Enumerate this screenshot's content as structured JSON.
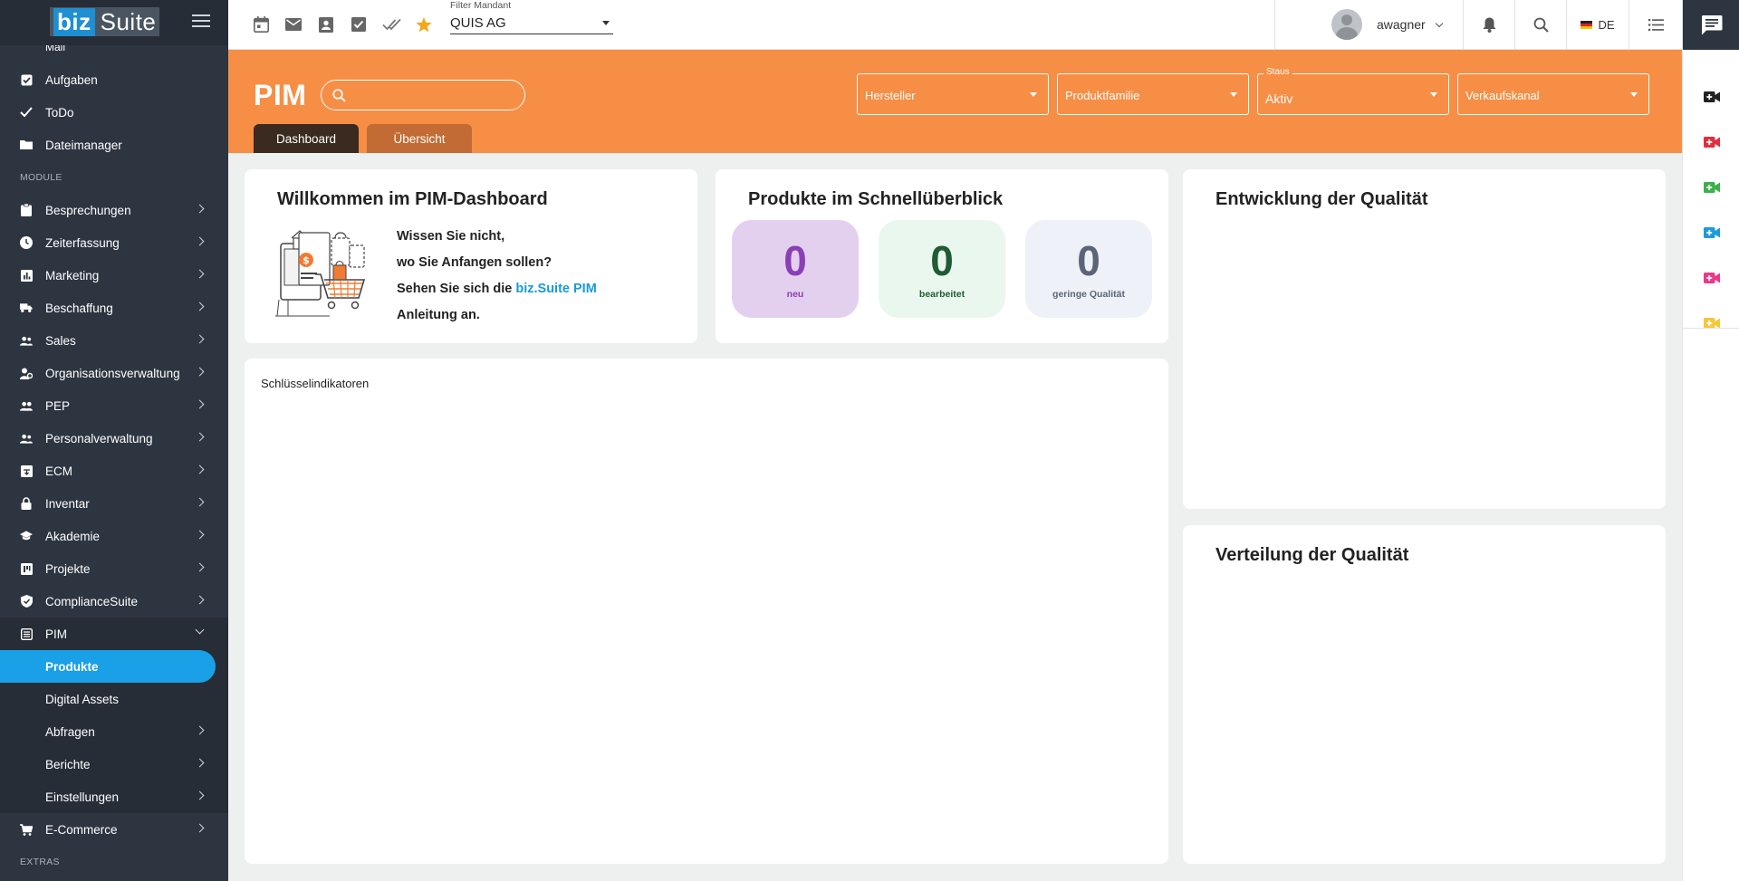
{
  "logo": {
    "part1": "biz",
    "part2": "Suite"
  },
  "sidebar": {
    "cut_item": "Mail",
    "top_items": [
      {
        "label": "Aufgaben",
        "icon": "checkbox-icon"
      },
      {
        "label": "ToDo",
        "icon": "check-icon"
      },
      {
        "label": "Dateimanager",
        "icon": "folder-icon"
      }
    ],
    "section_module": "MODULE",
    "modules": [
      {
        "label": "Besprechungen",
        "icon": "clipboard-icon"
      },
      {
        "label": "Zeiterfassung",
        "icon": "clock-icon"
      },
      {
        "label": "Marketing",
        "icon": "bar-chart-icon"
      },
      {
        "label": "Beschaffung",
        "icon": "truck-icon"
      },
      {
        "label": "Sales",
        "icon": "people-icon"
      },
      {
        "label": "Organisationsverwaltung",
        "icon": "org-icon"
      },
      {
        "label": "PEP",
        "icon": "group-icon"
      },
      {
        "label": "Personalverwaltung",
        "icon": "staff-icon"
      },
      {
        "label": "ECM",
        "icon": "archive-icon"
      },
      {
        "label": "Inventar",
        "icon": "lock-icon"
      },
      {
        "label": "Akademie",
        "icon": "graduation-cap-icon"
      },
      {
        "label": "Projekte",
        "icon": "project-icon"
      },
      {
        "label": "ComplianceSuite",
        "icon": "shield-icon"
      }
    ],
    "pim": {
      "label": "PIM",
      "icon": "list-box-icon"
    },
    "pim_sub": [
      {
        "label": "Produkte",
        "active": true,
        "chevron": false
      },
      {
        "label": "Digital Assets",
        "active": false,
        "chevron": false
      },
      {
        "label": "Abfragen",
        "active": false,
        "chevron": true
      },
      {
        "label": "Berichte",
        "active": false,
        "chevron": true
      },
      {
        "label": "Einstellungen",
        "active": false,
        "chevron": true
      }
    ],
    "ecommerce": {
      "label": "E-Commerce",
      "icon": "cart-icon"
    },
    "section_extras": "EXTRAS"
  },
  "topbar": {
    "icons": [
      "calendar-icon",
      "mail-icon",
      "contact-icon",
      "task-icon",
      "done-all-icon",
      "star-icon"
    ],
    "mandant_label": "Filter Mandant",
    "mandant_value": "QUIS AG",
    "user_name": "awagner",
    "lang": "DE"
  },
  "rail": {
    "icons": [
      {
        "name": "video-call-icon-dark",
        "color": "#222222"
      },
      {
        "name": "video-call-icon-red",
        "color": "#e03040"
      },
      {
        "name": "video-call-icon-green",
        "color": "#3cb04a"
      },
      {
        "name": "video-call-icon-blue",
        "color": "#1e9ad8"
      },
      {
        "name": "video-call-icon-pink",
        "color": "#e83a8a"
      },
      {
        "name": "video-call-icon-yellow",
        "color": "#f3c93a"
      }
    ]
  },
  "pim_header": {
    "title": "PIM",
    "search_placeholder": "",
    "filters": [
      {
        "placeholder": "Hersteller",
        "label": "",
        "value": ""
      },
      {
        "placeholder": "Produktfamilie",
        "label": "",
        "value": ""
      },
      {
        "placeholder": "",
        "label": "Staus",
        "value": "Aktiv"
      },
      {
        "placeholder": "Verkaufskanal",
        "label": "",
        "value": ""
      }
    ],
    "tabs": [
      {
        "label": "Dashboard",
        "active": true
      },
      {
        "label": "Übersicht",
        "active": false
      }
    ],
    "color": "#f78e45"
  },
  "welcome": {
    "title": "Willkommen im PIM-Dashboard",
    "line1": "Wissen Sie nicht,",
    "line2": "wo Sie Anfangen sollen?",
    "line3_pre": "Sehen Sie sich die ",
    "line3_link": "biz.Suite PIM",
    "line4": "Anleitung an."
  },
  "quick": {
    "title": "Produkte im Schnellüberblick",
    "stats": [
      {
        "value": "0",
        "label": "neu",
        "bg": "#e3d0ee",
        "color": "#8a3fb5"
      },
      {
        "value": "0",
        "label": "bearbeitet",
        "bg": "#eaf7ee",
        "color": "#1f5b34"
      },
      {
        "value": "0",
        "label": "geringe Qualität",
        "bg": "#eef1f7",
        "color": "#5b6577"
      }
    ]
  },
  "kpi": {
    "title": "Schlüsselindikatoren"
  },
  "quality_dev": {
    "title": "Entwicklung der Qualität"
  },
  "quality_dist": {
    "title": "Verteilung der Qualität"
  }
}
